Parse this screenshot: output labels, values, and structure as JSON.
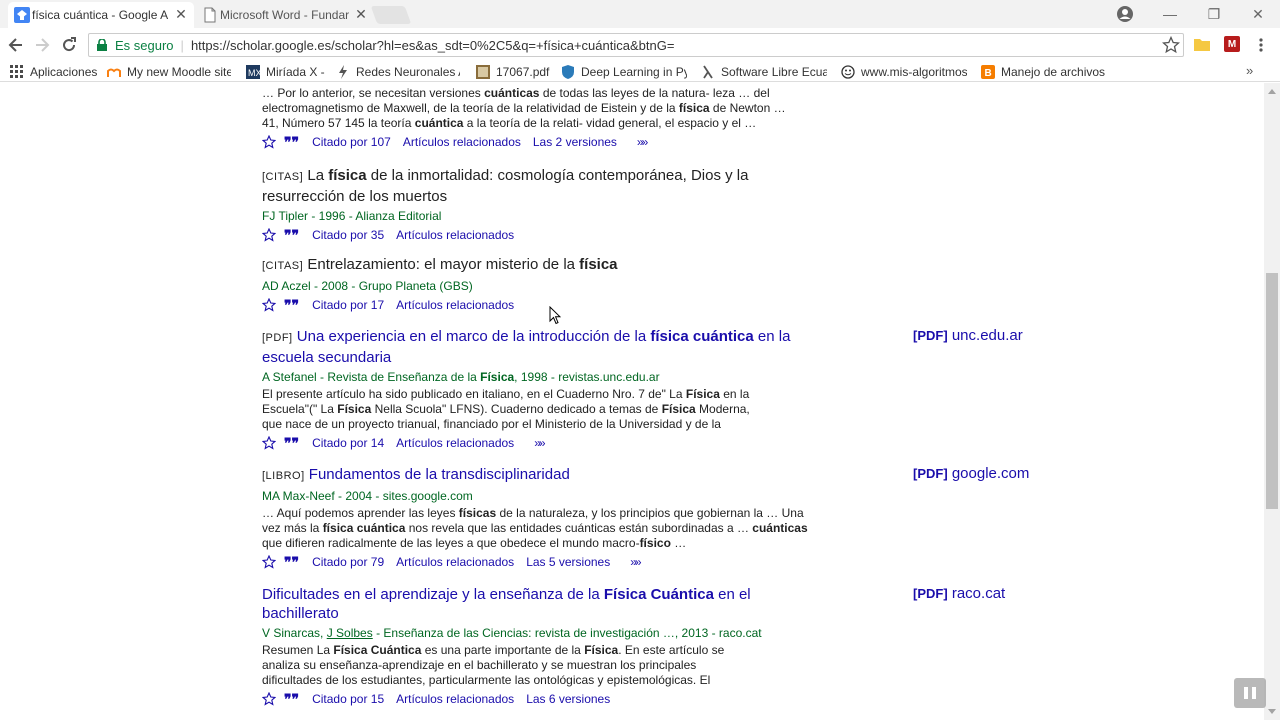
{
  "browser": {
    "tabs": [
      {
        "title": "física cuántica - Google A"
      },
      {
        "title": "Microsoft Word - Fundar"
      }
    ],
    "omnibox": {
      "security": "Es seguro",
      "url": "https://scholar.google.es/scholar?hl=es&as_sdt=0%2C5&q=+física+cuántica&btnG="
    },
    "bookmarks": [
      {
        "label": "Aplicaciones",
        "icon": "apps-grid-icon"
      },
      {
        "label": "My new Moodle site",
        "icon": "moodle-icon"
      },
      {
        "label": "Miríada X -",
        "icon": "miriadax-icon"
      },
      {
        "label": "Redes Neuronales Ar",
        "icon": "bolt-icon"
      },
      {
        "label": "17067.pdf",
        "icon": "pdf-thumbnail-icon"
      },
      {
        "label": "Deep Learning in Pyt",
        "icon": "shield-icon"
      },
      {
        "label": "Software Libre Ecuad",
        "icon": "lambda-icon"
      },
      {
        "label": "www.mis-algoritmos.",
        "icon": "smiley-icon"
      },
      {
        "label": "Manejo de archivos",
        "icon": "blogger-icon"
      }
    ]
  },
  "results": [
    {
      "snippet_lines": [
        [
          [
            "… Por lo anterior, se necesitan versiones ",
            false
          ],
          [
            "cuánticas",
            true
          ],
          [
            " de todas las leyes de la natura- leza … del",
            false
          ]
        ],
        [
          [
            "electromagnetismo de Maxwell, de la teoría de la relatividad de Eistein y de la ",
            false
          ],
          [
            "física",
            true
          ],
          [
            " de Newton …",
            false
          ]
        ],
        [
          [
            "41, Número 57 145 la teoría ",
            false
          ],
          [
            "cuántica",
            true
          ],
          [
            " a la teoría de la relati- vidad general, el espacio y el …",
            false
          ]
        ]
      ],
      "links": [
        "Citado por 107",
        "Artículos relacionados",
        "Las 2 versiones"
      ]
    },
    {
      "kind": "[CITAS]",
      "title_parts": [
        [
          "La ",
          false
        ],
        [
          "física",
          true
        ],
        [
          " de la inmortalidad: cosmología contemporánea, Dios y la",
          false
        ]
      ],
      "title_line2": "resurrección de los muertos",
      "meta": "FJ Tipler - 1996 - Alianza Editorial",
      "links": [
        "Citado por 35",
        "Artículos relacionados"
      ]
    },
    {
      "kind": "[CITAS]",
      "title_parts": [
        [
          "Entrelazamiento: el mayor misterio de la ",
          false
        ],
        [
          "física",
          true
        ]
      ],
      "meta": "AD Aczel - 2008 - Grupo Planeta (GBS)",
      "links": [
        "Citado por 17",
        "Artículos relacionados"
      ]
    },
    {
      "kind": "[PDF]",
      "title_parts": [
        [
          "Una experiencia en el marco de la introducción de la ",
          false
        ],
        [
          "física cuántica",
          true
        ],
        [
          " en la",
          false
        ]
      ],
      "title_line2": "escuela secundaria",
      "meta_parts": [
        [
          "A Stefanel - Revista de Enseñanza de la ",
          false
        ],
        [
          "Física",
          true
        ],
        [
          ", 1998 - revistas.unc.edu.ar",
          false
        ]
      ],
      "snippet_lines": [
        [
          [
            "El presente artículo ha sido publicado en italiano, en el Cuaderno Nro. 7 de\" La ",
            false
          ],
          [
            "Física",
            true
          ],
          [
            " en la",
            false
          ]
        ],
        [
          [
            "Escuela\"(\" La ",
            false
          ],
          [
            "Física",
            true
          ],
          [
            " Nella Scuola\" LFNS). Cuaderno dedicado a temas de ",
            false
          ],
          [
            "Física",
            true
          ],
          [
            " Moderna,",
            false
          ]
        ],
        [
          [
            "que nace de un proyecto trianual, financiado por el Ministerio de la Universidad y de la",
            false
          ]
        ]
      ],
      "links": [
        "Citado por 14",
        "Artículos relacionados"
      ],
      "side": {
        "tag": "[PDF]",
        "domain": "unc.edu.ar"
      }
    },
    {
      "kind": "[LIBRO]",
      "title_parts": [
        [
          "Fundamentos de la transdisciplinaridad",
          false
        ]
      ],
      "meta": "MA Max-Neef - 2004 - sites.google.com",
      "snippet_lines": [
        [
          [
            "… Aquí podemos aprender las leyes ",
            false
          ],
          [
            "físicas",
            true
          ],
          [
            " de la naturaleza, y los principios que gobiernan la … Una",
            false
          ]
        ],
        [
          [
            "vez más la ",
            false
          ],
          [
            "física cuántica",
            true
          ],
          [
            " nos revela que las entidades cuánticas están subordinadas a … ",
            false
          ],
          [
            "cuánticas",
            true
          ]
        ],
        [
          [
            "que difieren radicalmente de las leyes a que obedece el mundo macro-",
            false
          ],
          [
            "físico",
            true
          ],
          [
            " …",
            false
          ]
        ]
      ],
      "links": [
        "Citado por 79",
        "Artículos relacionados",
        "Las 5 versiones"
      ],
      "side": {
        "tag": "[PDF]",
        "domain": "google.com"
      }
    },
    {
      "title_parts": [
        [
          "Dificultades en el aprendizaje y la enseñanza de la ",
          false
        ],
        [
          "Física Cuántica",
          true
        ],
        [
          " en el",
          false
        ]
      ],
      "title_line2": "bachillerato",
      "meta_parts": [
        [
          "V Sinarcas, ",
          false
        ],
        [
          "J Solbes",
          "u"
        ],
        [
          " - Enseñanza de las Ciencias: revista de investigación …, 2013 - raco.cat",
          false
        ]
      ],
      "snippet_lines": [
        [
          [
            "Resumen La ",
            false
          ],
          [
            "Física Cuántica",
            true
          ],
          [
            " es una parte importante de la ",
            false
          ],
          [
            "Física",
            true
          ],
          [
            ". En este artículo se",
            false
          ]
        ],
        [
          [
            "analiza su enseñanza-aprendizaje en el bachillerato y se muestran los principales",
            false
          ]
        ],
        [
          [
            "dificultades de los estudiantes, particularmente las ontológicas y epistemológicas. El",
            false
          ]
        ]
      ],
      "links": [
        "Citado por 15",
        "Artículos relacionados",
        "Las 6 versiones"
      ],
      "side": {
        "tag": "[PDF]",
        "domain": "raco.cat"
      }
    }
  ],
  "colors": {
    "link": "#1a0dab",
    "meta": "#006621",
    "secure": "#0b8043"
  }
}
